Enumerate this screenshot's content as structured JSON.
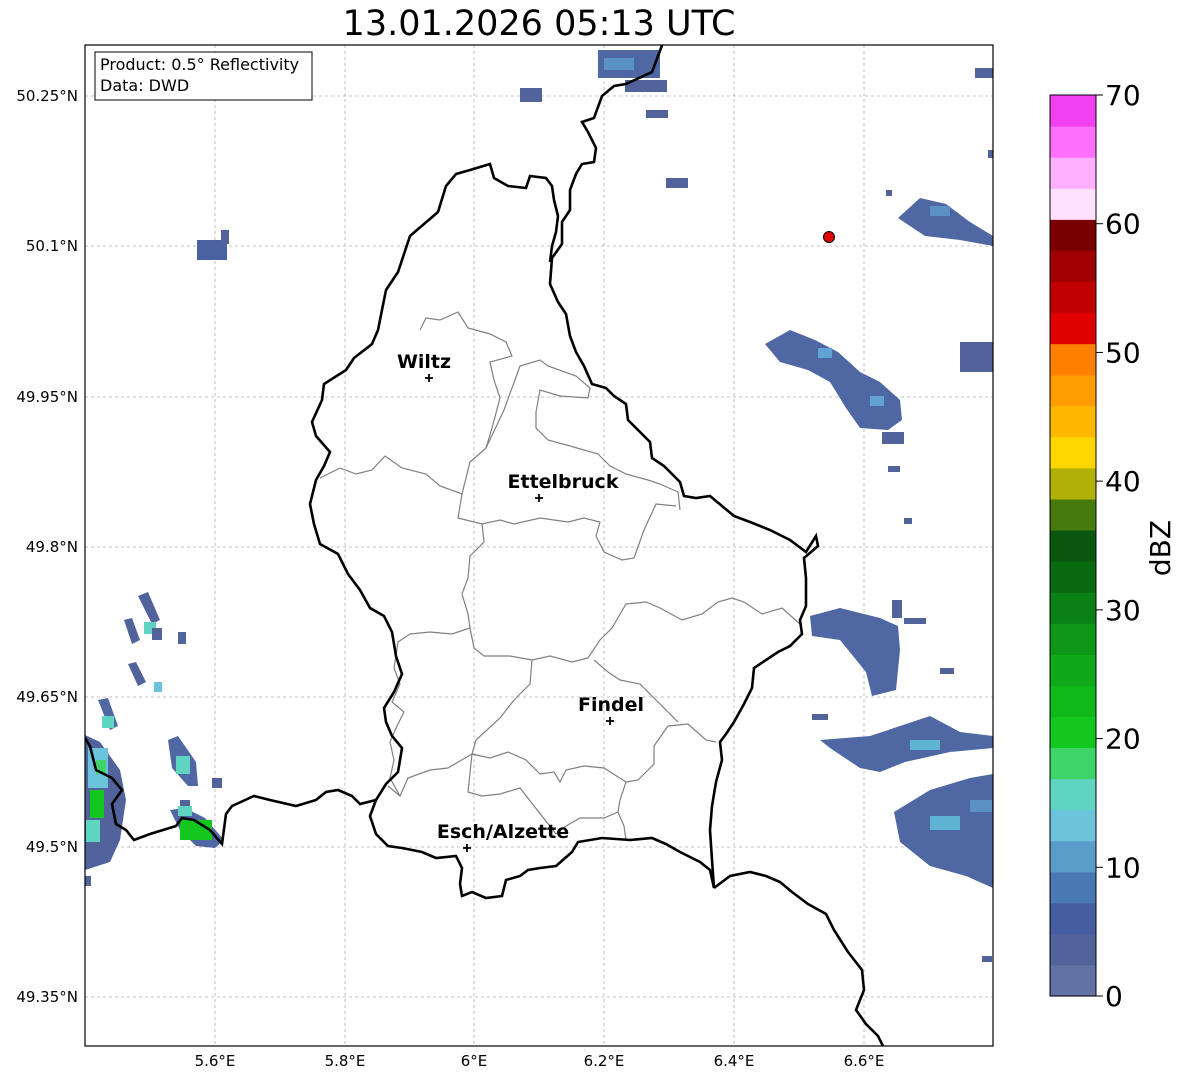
{
  "title": "13.01.2026 05:13 UTC",
  "info_box": {
    "product": "Product: 0.5° Reflectivity",
    "data": "Data: DWD"
  },
  "lat_ticks": [
    "50.25°N",
    "50.1°N",
    "49.95°N",
    "49.8°N",
    "49.65°N",
    "49.5°N",
    "49.35°N"
  ],
  "lon_ticks": [
    "5.6°E",
    "5.8°E",
    "6°E",
    "6.2°E",
    "6.4°E",
    "6.6°E"
  ],
  "cities": [
    {
      "name": "Wiltz"
    },
    {
      "name": "Ettelbruck"
    },
    {
      "name": "Findel"
    },
    {
      "name": "Esch/Alzette"
    }
  ],
  "colorbar": {
    "label": "dBZ",
    "ticks": [
      "0",
      "10",
      "20",
      "30",
      "40",
      "50",
      "60",
      "70"
    ],
    "colors": [
      "#6272a4",
      "#52639c",
      "#445ea0",
      "#4a78b0",
      "#5a9cc8",
      "#6bc4dc",
      "#5fd4c0",
      "#3fd46a",
      "#12c81e",
      "#10b81a",
      "#10a818",
      "#0e9616",
      "#0b8014",
      "#096a12",
      "#0a560e",
      "#467a0c",
      "#b0b20a",
      "#ffd700",
      "#ffb700",
      "#ff9c00",
      "#ff7f00",
      "#e00000",
      "#c00000",
      "#a00000",
      "#7a0000",
      "#ffe0ff",
      "#ffb0ff",
      "#ff70ff",
      "#f040f0"
    ]
  },
  "radar_marker_color": "#e00000"
}
